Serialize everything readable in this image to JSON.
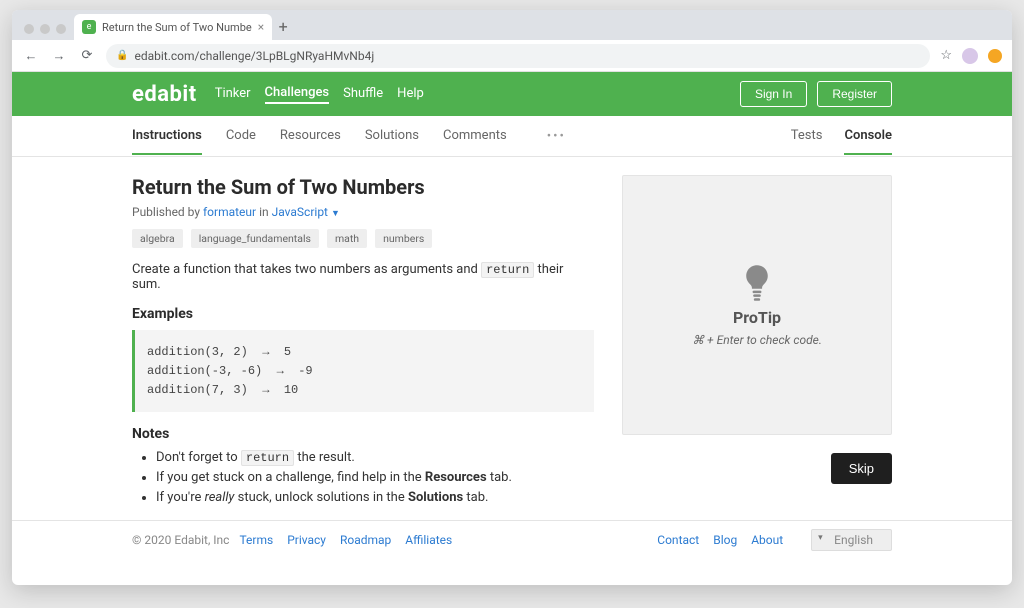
{
  "browser": {
    "tab_title": "Return the Sum of Two Numbe",
    "url": "edabit.com/challenge/3LpBLgNRyaHMvNb4j"
  },
  "header": {
    "brand": "edabit",
    "nav": {
      "tinker": "Tinker",
      "challenges": "Challenges",
      "shuffle": "Shuffle",
      "help": "Help"
    },
    "signin": "Sign In",
    "register": "Register"
  },
  "subnav": {
    "left": {
      "instructions": "Instructions",
      "code": "Code",
      "resources": "Resources",
      "solutions": "Solutions",
      "comments": "Comments"
    },
    "right": {
      "tests": "Tests",
      "console": "Console"
    }
  },
  "challenge": {
    "title": "Return the Sum of Two Numbers",
    "published_prefix": "Published by ",
    "author": "formateur",
    "in_word": " in ",
    "language": "JavaScript",
    "tags": [
      "algebra",
      "language_fundamentals",
      "math",
      "numbers"
    ],
    "desc_a": "Create a function that takes two numbers as arguments and ",
    "desc_code": "return",
    "desc_b": " their sum.",
    "examples_heading": "Examples",
    "examples": [
      "addition(3, 2)  →  5",
      "addition(-3, -6)  →  -9",
      "addition(7, 3)  →  10"
    ],
    "notes_heading": "Notes",
    "note1_a": "Don't forget to ",
    "note1_code": "return",
    "note1_b": " the result.",
    "note2_a": "If you get stuck on a challenge, find help in the ",
    "note2_bold": "Resources",
    "note2_b": " tab.",
    "note3_a": "If you're ",
    "note3_italic": "really",
    "note3_b": " stuck, unlock solutions in the ",
    "note3_bold": "Solutions",
    "note3_c": " tab."
  },
  "console": {
    "protip_title": "ProTip",
    "protip_sub": "⌘ + Enter to check code.",
    "skip": "Skip"
  },
  "footer": {
    "copyright": "© 2020 Edabit, Inc",
    "links": {
      "terms": "Terms",
      "privacy": "Privacy",
      "roadmap": "Roadmap",
      "affiliates": "Affiliates"
    },
    "rlinks": {
      "contact": "Contact",
      "blog": "Blog",
      "about": "About"
    },
    "language": "English"
  }
}
